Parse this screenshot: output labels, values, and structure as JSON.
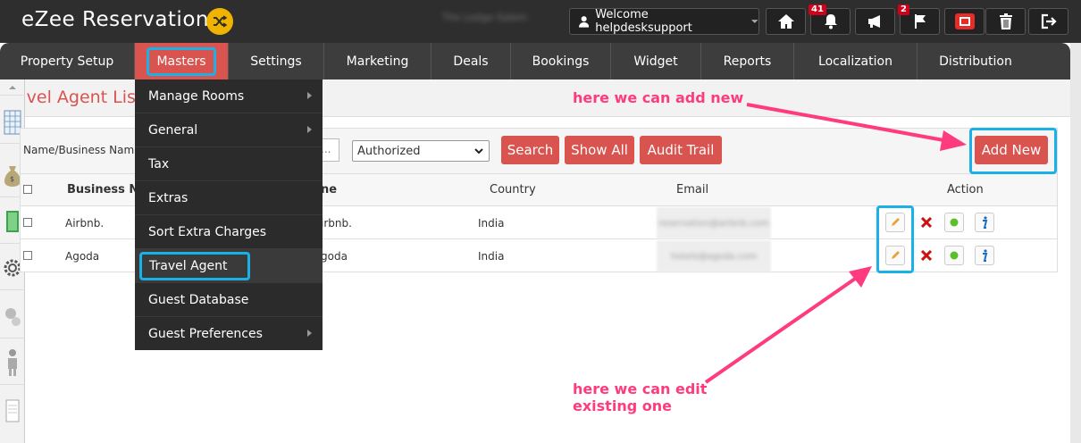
{
  "header": {
    "app_title": "eZee Reservation",
    "hotel_name": "The Lodge Salem",
    "welcome": "Welcome helpdesksupport",
    "notifications_count": "41",
    "flags_count": "2"
  },
  "nav": {
    "items": [
      "Property Setup",
      "Masters",
      "Settings",
      "Marketing",
      "Deals",
      "Bookings",
      "Widget",
      "Reports",
      "Localization",
      "Distribution"
    ]
  },
  "masters_menu": {
    "items": [
      "Manage Rooms",
      "General",
      "Tax",
      "Extras",
      "Sort Extra Charges",
      "Travel Agent",
      "Guest Database",
      "Guest Preferences"
    ]
  },
  "page": {
    "title": "avel Agent Lis"
  },
  "filters": {
    "label": "Name/Business Name",
    "search_value": "...",
    "status_selected": "Authorized",
    "search_button": "Search",
    "show_all_button": "Show All",
    "audit_trail_button": "Audit Trail",
    "add_new_button": "Add New"
  },
  "table": {
    "headers": {
      "business_name": "Business Nar",
      "name": "ne",
      "country": "Country",
      "email": "Email",
      "action": "Action"
    },
    "rows": [
      {
        "business_name": "Airbnb.",
        "name": "irbnb.",
        "country": "India",
        "email": "reservation@airbnb.com"
      },
      {
        "business_name": "Agoda",
        "name": "goda",
        "country": "India",
        "email": "hotels@agoda.com"
      }
    ]
  },
  "annotations": {
    "add_new": "here we can add new",
    "edit_line1": "here we can edit",
    "edit_line2": "existing one"
  },
  "colors": {
    "accent_red": "#d9534f",
    "highlight_blue": "#1ab0e8",
    "annotation_pink": "#ff3b7f"
  }
}
